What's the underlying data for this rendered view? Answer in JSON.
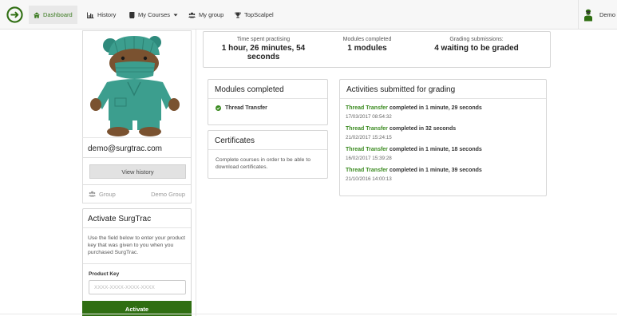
{
  "nav": {
    "items": [
      {
        "label": "Dashboard",
        "icon": "home-icon",
        "active": true
      },
      {
        "label": "History",
        "icon": "bar-chart-icon"
      },
      {
        "label": "My Courses",
        "icon": "book-icon",
        "dropdown": true
      },
      {
        "label": "My group",
        "icon": "group-icon"
      },
      {
        "label": "TopScalpel",
        "icon": "trophy-icon"
      }
    ],
    "user": {
      "name": "Demo",
      "icon": "surgeon-avatar-icon"
    }
  },
  "colors": {
    "accent": "#3a8a1f",
    "activate_button": "#2f6e12"
  },
  "profile": {
    "email": "demo@surgtrac.com",
    "view_history_label": "View history",
    "group_label": "Group",
    "group_value": "Demo Group"
  },
  "activate": {
    "title": "Activate SurgTrac",
    "text": "Use the field below to enter your product key that was given to you when you purchased SurgTrac.",
    "key_label": "Product Key",
    "key_placeholder": "XXXX-XXXX-XXXX-XXXX",
    "button_label": "Activate"
  },
  "stats": [
    {
      "label": "Time spent practising",
      "value": "1 hour, 26 minutes, 54 seconds"
    },
    {
      "label": "Modules completed",
      "value": "1 modules"
    },
    {
      "label": "Grading submissions:",
      "value": "4 waiting to be graded"
    }
  ],
  "modules": {
    "title": "Modules completed",
    "items": [
      "Thread Transfer"
    ]
  },
  "certificates": {
    "title": "Certificates",
    "text": "Complete courses in order to be able to download certificates."
  },
  "grading": {
    "title": "Activities submitted for grading",
    "entries": [
      {
        "activity": "Thread Transfer",
        "text": " completed in 1 minute, 29 seconds",
        "date": "17/03/2017 08:54:32"
      },
      {
        "activity": "Thread Transfer",
        "text": " completed in 32 seconds",
        "date": "21/02/2017 15:24:15"
      },
      {
        "activity": "Thread Transfer",
        "text": " completed in 1 minute, 18 seconds",
        "date": "16/02/2017 15:39:28"
      },
      {
        "activity": "Thread Transfer",
        "text": " completed in 1 minute, 39 seconds",
        "date": "21/10/2016 14:00:13"
      }
    ]
  }
}
